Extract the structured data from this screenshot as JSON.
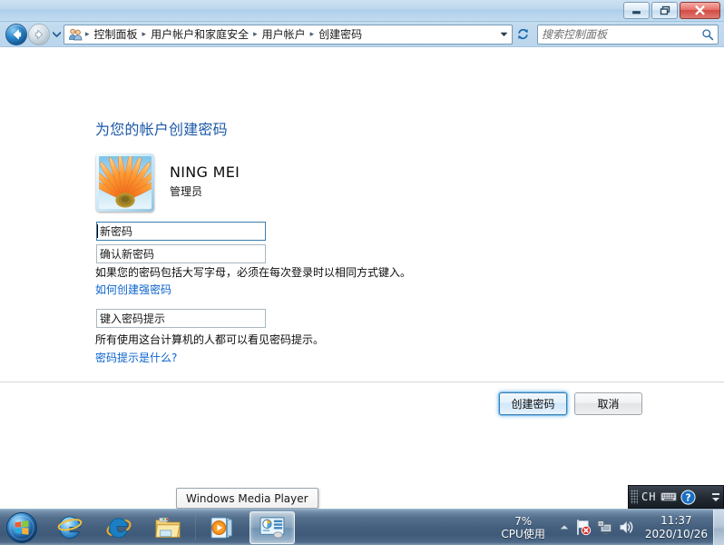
{
  "window": {
    "buttons": {
      "minimize": "minimize",
      "restore": "restore",
      "close": "close"
    }
  },
  "nav": {
    "back_tooltip": "后退",
    "forward_tooltip": "前进",
    "history_tooltip": "最近访问的页面",
    "breadcrumb_icon": "user-accounts-icon",
    "breadcrumbs": [
      "控制面板",
      "用户帐户和家庭安全",
      "用户帐户",
      "创建密码"
    ],
    "separator": "▸",
    "refresh_tooltip": "刷新"
  },
  "search": {
    "placeholder": "搜索控制面板",
    "value": ""
  },
  "main": {
    "title": "为您的帐户创建密码",
    "account": {
      "name": "NING MEI",
      "role": "管理员",
      "avatar": "flower-avatar"
    },
    "fields": [
      {
        "name": "new-password",
        "placeholder": "新密码",
        "value": "",
        "focused": true
      },
      {
        "name": "confirm-password",
        "placeholder": "确认新密码",
        "value": "",
        "focused": false
      },
      {
        "name": "password-hint",
        "placeholder": "键入密码提示",
        "value": "",
        "focused": false
      }
    ],
    "note_password": "如果您的密码包括大写字母，必须在每次登录时以相同方式键入。",
    "link_strong_password": "如何创建强密码",
    "note_hint": "所有使用这台计算机的人都可以看见密码提示。",
    "link_hint_what": "密码提示是什么?",
    "buttons": {
      "create": "创建密码",
      "cancel": "取消"
    }
  },
  "tooltip": {
    "text": "Windows Media Player"
  },
  "ime": {
    "grip": "drag-grip",
    "language": "CH",
    "keyboard_icon": "keyboard-icon",
    "help_icon": "help-icon",
    "minimize_icon": "minimize-icon",
    "options_icon": "chevron-down-icon"
  },
  "taskbar": {
    "start": "start-orb",
    "items": [
      {
        "name": "internet-explorer-pinned",
        "icon": "ie-blue-icon",
        "active": false
      },
      {
        "name": "internet-explorer",
        "icon": "ie-classic-icon",
        "active": false
      },
      {
        "name": "windows-explorer",
        "icon": "folder-icon",
        "active": false
      },
      {
        "name": "windows-media-player",
        "icon": "media-player-icon",
        "active": false
      },
      {
        "name": "control-panel",
        "icon": "control-panel-icon",
        "active": true
      }
    ],
    "tray": {
      "cpu_value": "7%",
      "cpu_label": "CPU使用",
      "show_hidden": "show-hidden-icons",
      "icons": [
        {
          "name": "action-center-icon",
          "badge": "error"
        },
        {
          "name": "network-icon",
          "badge": ""
        },
        {
          "name": "volume-icon",
          "badge": ""
        }
      ],
      "time": "11:37",
      "date": "2020/10/26",
      "show_desktop": "show-desktop-button"
    }
  },
  "colors": {
    "title_blue": "#1c59a8",
    "link_blue": "#0b63ce",
    "accent_focus": "#3c7fb1",
    "close_red": "#d04a43"
  }
}
